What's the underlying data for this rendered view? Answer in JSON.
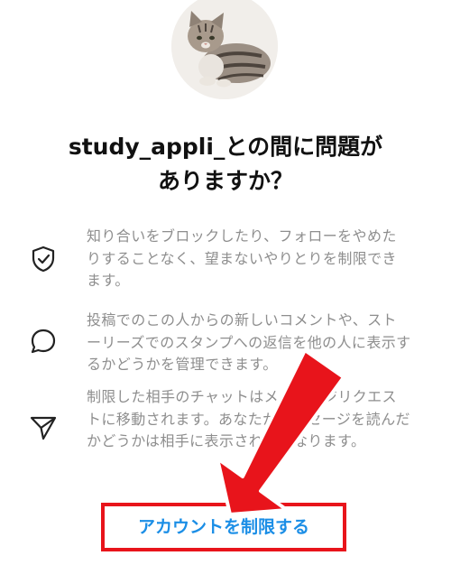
{
  "header": {
    "title_line1": "study_appli_との間に問題が",
    "title_line2": "ありますか？"
  },
  "items": [
    {
      "icon": "shield-check-icon",
      "text": "知り合いをブロックしたり、フォローをやめたりすることなく、望まないやりとりを制限できます。"
    },
    {
      "icon": "speech-bubble-icon",
      "text": "投稿でのこの人からの新しいコメントや、ストーリーズでのスタンプへの返信を他の人に表示するかどうかを管理できます。"
    },
    {
      "icon": "paper-plane-icon",
      "text": "制限した相手のチャットはメッセージリクエストに移動されます。あなたがメッセージを読んだかどうかは相手に表示されなくなります。"
    }
  ],
  "action": {
    "label": "アカウントを制限する"
  },
  "colors": {
    "accent": "#1b8ee6",
    "highlight": "#e8141b",
    "muted_text": "#8e8e8e"
  }
}
